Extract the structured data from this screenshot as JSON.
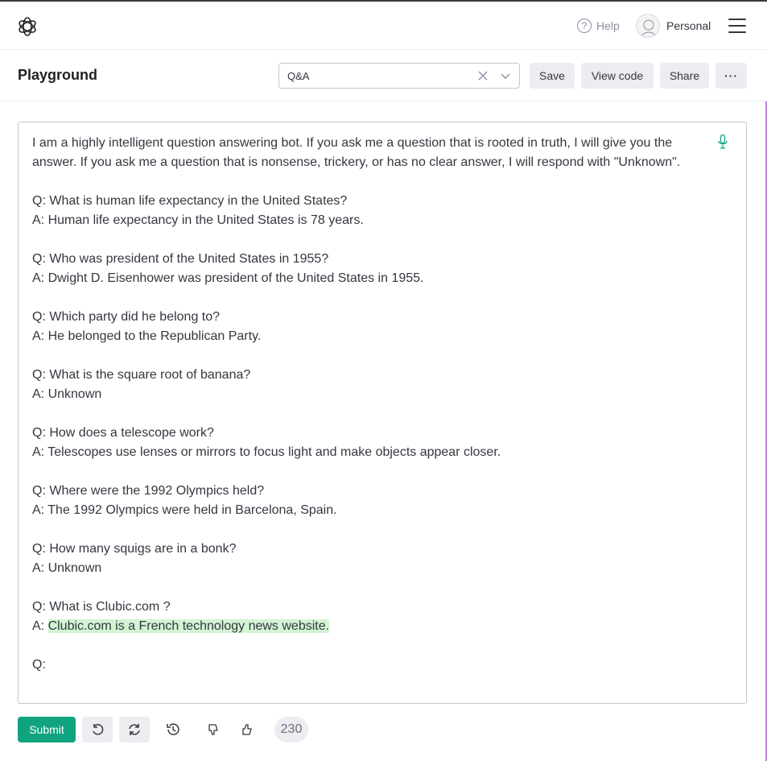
{
  "nav": {
    "help_label": "Help",
    "account_label": "Personal"
  },
  "header": {
    "title": "Playground",
    "preset_value": "Q&A",
    "save_label": "Save",
    "view_code_label": "View code",
    "share_label": "Share",
    "more_label": "···"
  },
  "editor": {
    "lines": [
      "I am a highly intelligent question answering bot. If you ask me a question that is rooted in truth, I will give you the",
      "answer. If you ask me a question that is nonsense, trickery, or has no clear answer, I will respond with \"Unknown\".",
      "",
      "Q: What is human life expectancy in the United States?",
      "A: Human life expectancy in the United States is 78 years.",
      "",
      "Q: Who was president of the United States in 1955?",
      "A: Dwight D. Eisenhower was president of the United States in 1955.",
      "",
      "Q: Which party did he belong to?",
      "A: He belonged to the Republican Party.",
      "",
      "Q: What is the square root of banana?",
      "A: Unknown",
      "",
      "Q: How does a telescope work?",
      "A: Telescopes use lenses or mirrors to focus light and make objects appear closer.",
      "",
      "Q: Where were the 1992 Olympics held?",
      "A: The 1992 Olympics were held in Barcelona, Spain.",
      "",
      "Q: How many squigs are in a bonk?",
      "A: Unknown",
      "",
      "Q: What is Clubic.com ?"
    ],
    "answer_prefix": "A: ",
    "completion": "Clubic.com is a French technology news website.",
    "next_prompt": "Q:"
  },
  "toolbar": {
    "submit_label": "Submit",
    "token_count": "230"
  },
  "colors": {
    "accent": "#10a37f",
    "completion_highlight": "#d2f4d3"
  },
  "icons": [
    "openai-logo-icon",
    "help-icon",
    "avatar",
    "hamburger-menu-icon",
    "clear-icon",
    "chevron-down-icon",
    "microphone-icon",
    "undo-icon",
    "regenerate-icon",
    "history-icon",
    "thumbs-down-icon",
    "thumbs-up-icon"
  ]
}
